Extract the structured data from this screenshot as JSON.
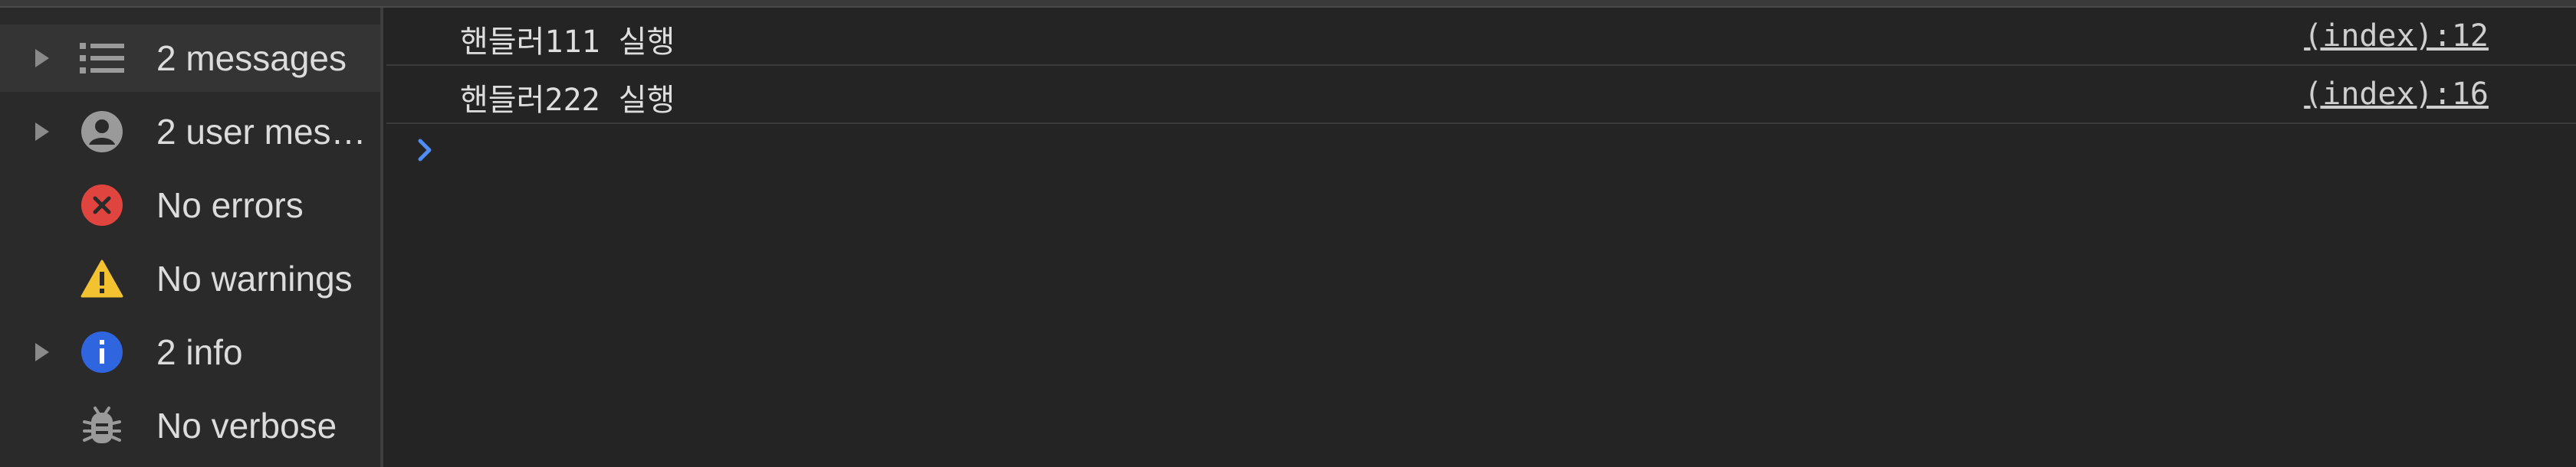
{
  "sidebar": {
    "items": [
      {
        "label": "2 messages",
        "icon": "list-icon"
      },
      {
        "label": "2 user mes…",
        "icon": "user-circle-icon"
      },
      {
        "label": "No errors",
        "icon": "error-icon"
      },
      {
        "label": "No warnings",
        "icon": "warning-icon"
      },
      {
        "label": "2 info",
        "icon": "info-icon"
      },
      {
        "label": "No verbose",
        "icon": "bug-icon"
      }
    ]
  },
  "console": {
    "messages": [
      {
        "text": "핸들러111 실행",
        "source": "(index):12"
      },
      {
        "text": "핸들러222 실행",
        "source": "(index):16"
      }
    ],
    "prompt_icon": "chevron-right-icon"
  },
  "colors": {
    "background": "#242424",
    "sidebar": "#2a2a2a",
    "selected": "#343434",
    "error": "#e0443e",
    "warning": "#f2c230",
    "info": "#2f66e0",
    "prompt": "#4d8df5"
  }
}
